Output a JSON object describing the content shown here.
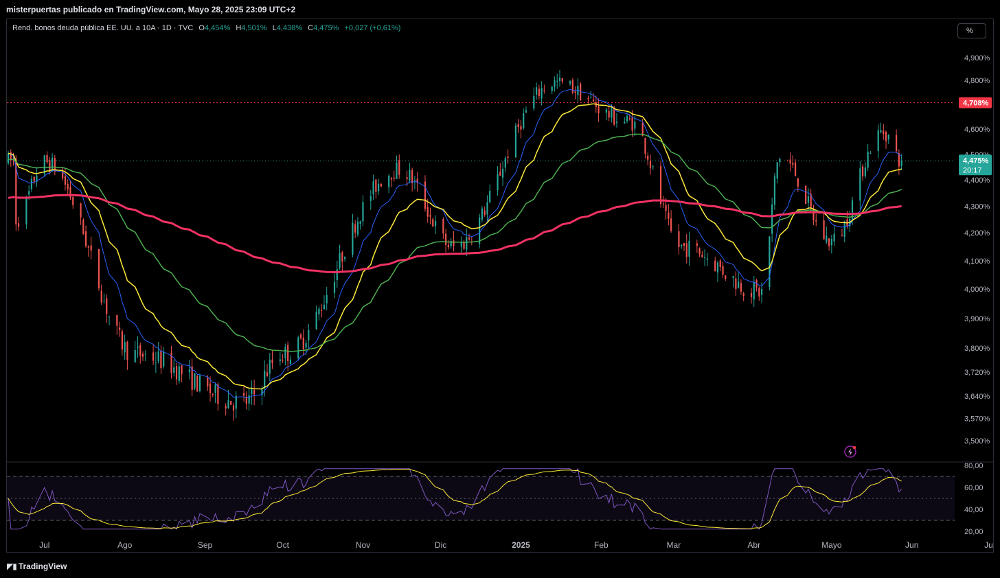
{
  "header": {
    "title": "misterpuertas publicado en TradingView.com, Mayo 28, 2025 23:09 UTC+2"
  },
  "legend": {
    "symbol": "Rend. bonos deuda pública EE. UU. a 10A · 1D · TVC",
    "o_label": "O",
    "o_value": "4,454%",
    "h_label": "H",
    "h_value": "4,501%",
    "l_label": "L",
    "l_value": "4,438%",
    "c_label": "C",
    "c_value": "4,475%",
    "change": "+0,027 (+0,61%)"
  },
  "scale_button": "%",
  "brand": "TradingView",
  "colors": {
    "up": "#26a69a",
    "down": "#ef5350",
    "ema_fast": "#2962ff",
    "ema_mid": "#ffeb3b",
    "ema_slow": "#4caf50",
    "ema_long": "#f23264",
    "rsi": "#7e57c2",
    "rsi_ma": "#ffeb3b"
  },
  "chart_data": {
    "type": "candlestick",
    "title": "Rend. bonos deuda pública EE. UU. a 10A · 1D · TVC",
    "y_unit": "%",
    "y_ticks": [
      "4,900%",
      "4,800%",
      "4,600%",
      "4,500%",
      "4,400%",
      "4,300%",
      "4,200%",
      "4,100%",
      "4,000%",
      "3,900%",
      "3,800%",
      "3,720%",
      "3,640%",
      "3,570%",
      "3,500%"
    ],
    "x_ticks": [
      "Jul",
      "Ago",
      "Sep",
      "Oct",
      "Nov",
      "Dic",
      "2025",
      "Feb",
      "Mar",
      "Abr",
      "Mayo",
      "Jun",
      "Jul"
    ],
    "resistance_line": {
      "value": 4.708,
      "label": "4,708%"
    },
    "last_price": {
      "value": 4.475,
      "label": "4,475%",
      "countdown": "20:17"
    },
    "key_points": [
      {
        "date": "2024-06-20",
        "close": 4.25
      },
      {
        "date": "2024-07-01",
        "close": 4.47
      },
      {
        "date": "2024-08-05",
        "close": 3.78
      },
      {
        "date": "2024-09-16",
        "close": 3.62
      },
      {
        "date": "2024-10-01",
        "close": 3.78
      },
      {
        "date": "2024-11-15",
        "close": 4.44
      },
      {
        "date": "2024-12-06",
        "close": 4.15
      },
      {
        "date": "2025-01-14",
        "close": 4.79
      },
      {
        "date": "2025-02-12",
        "close": 4.63
      },
      {
        "date": "2025-03-04",
        "close": 4.15
      },
      {
        "date": "2025-04-04",
        "close": 3.99
      },
      {
        "date": "2025-04-11",
        "close": 4.49
      },
      {
        "date": "2025-05-01",
        "close": 4.17
      },
      {
        "date": "2025-05-21",
        "close": 4.59
      },
      {
        "date": "2025-05-28",
        "close": 4.475
      }
    ],
    "series": [
      {
        "values_note": "",
        "kind": "ema_fast"
      },
      {
        "kind": "ema_mid"
      },
      {
        "kind": "ema_slow"
      },
      {
        "kind": "ema_long"
      }
    ],
    "rsi": {
      "y_ticks": [
        "80,00",
        "60,00",
        "40,00",
        "20,00"
      ],
      "band": [
        30,
        70
      ]
    }
  }
}
